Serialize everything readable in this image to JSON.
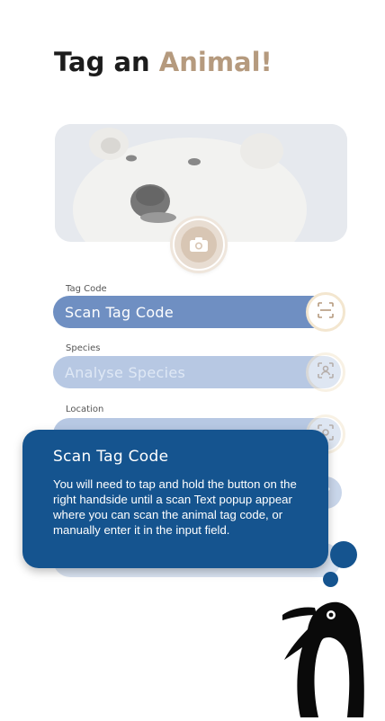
{
  "header": {
    "title_main": "Tag an",
    "title_accent": "Animal!"
  },
  "photo": {
    "alt": "polar bear"
  },
  "fields": [
    {
      "label": "Tag Code",
      "value": "Scan Tag Code"
    },
    {
      "label": "Species",
      "value": "Analyse Species"
    },
    {
      "label": "Location",
      "value": ""
    }
  ],
  "tooltip": {
    "title": "Scan Tag Code",
    "body": "You will need to tap and hold the button on the right handside until a scan Text popup appear where you can scan the animal tag code, or manually enter it in the input field."
  },
  "icons": {
    "camera": "camera-icon",
    "scan": "scan-icon",
    "species_scan": "face-scan-icon",
    "location": "location-icon",
    "edit": "pencil-icon",
    "mascot": "penguin-icon"
  },
  "colors": {
    "accent": "#b59a7e",
    "primary": "#15548f",
    "field_active": "#6f8fc2",
    "field_faded": "#b7c8e3"
  }
}
